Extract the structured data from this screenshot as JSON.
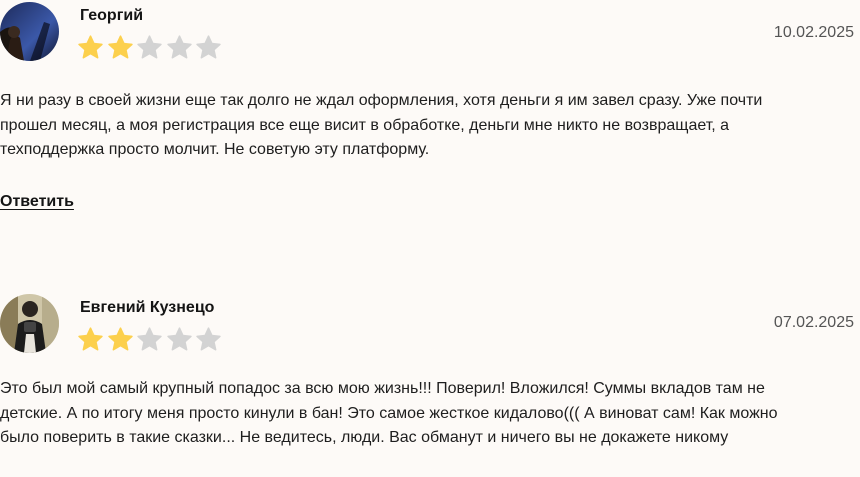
{
  "colors": {
    "background": "#fdfaf7",
    "star_filled": "#fcd04d",
    "star_empty": "#d3d3d3"
  },
  "reviews": [
    {
      "author": "Георгий",
      "date": "10.02.2025",
      "rating": 2,
      "max_rating": 5,
      "text": "Я ни разу в своей жизни еще так долго не ждал оформления, хотя деньги я им завел сразу. Уже почти прошел месяц, а моя регистрация все еще висит в обработке, деньги мне никто не возвращает, а техподдержка просто молчит. Не советую эту платформу.",
      "reply_label": "Ответить",
      "avatar_icon": "user-photo-avatar"
    },
    {
      "author": "Евгений Кузнецо",
      "date": "07.02.2025",
      "rating": 2,
      "max_rating": 5,
      "text": "Это был мой самый крупный попадос за всю мою жизнь!!! Поверил! Вложился! Суммы вкладов там не детские. А по итогу меня просто кинули в бан! Это самое жесткое кидалово((( А виноват сам! Как можно было поверить в такие сказки... Не ведитесь, люди. Вас обманут и ничего вы не докажете никому",
      "avatar_icon": "user-photo-avatar"
    }
  ]
}
